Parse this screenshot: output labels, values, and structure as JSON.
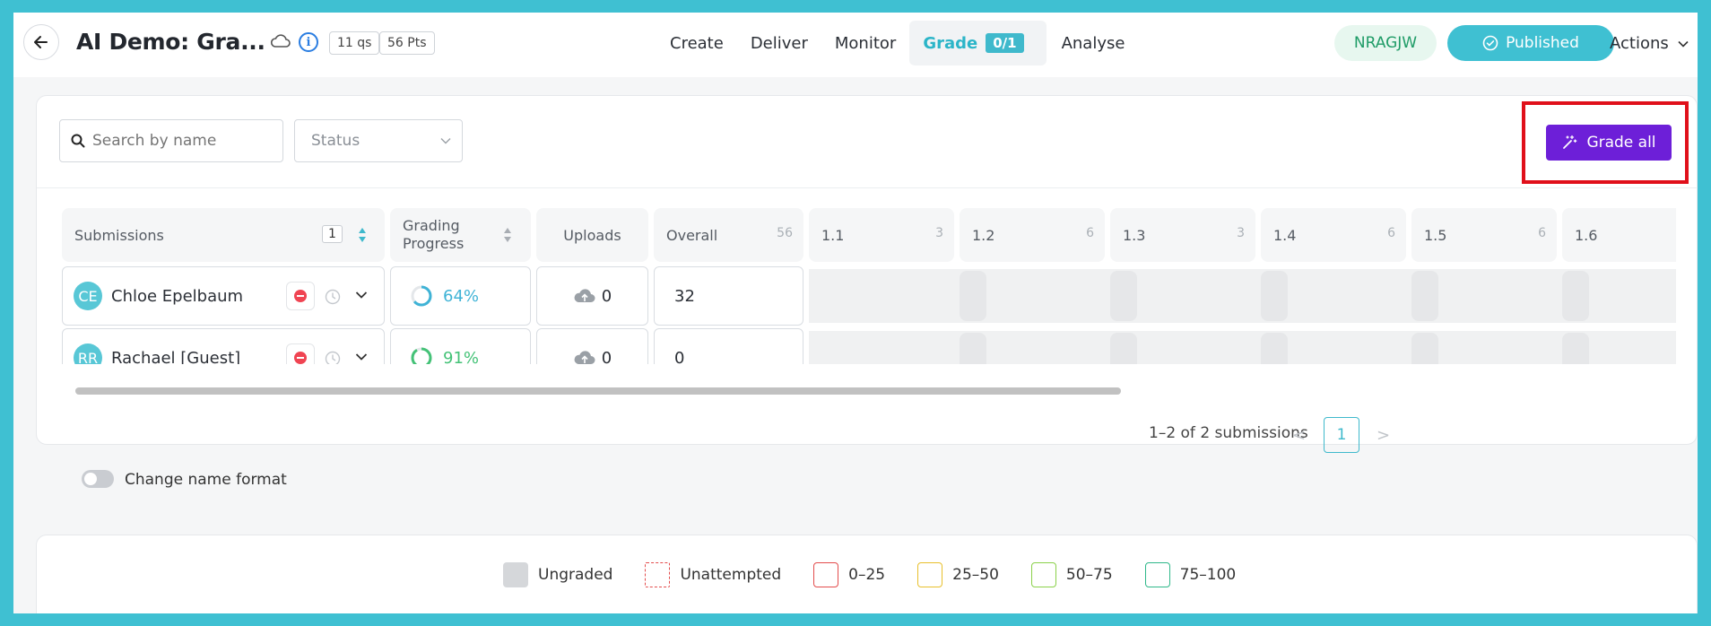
{
  "header": {
    "title": "AI Demo: Gra...",
    "questions_chip": "11 qs",
    "points_chip": "56 Pts",
    "nav": [
      {
        "label": "Create"
      },
      {
        "label": "Deliver"
      },
      {
        "label": "Monitor"
      },
      {
        "label": "Grade",
        "badge": "0/1",
        "active": true
      },
      {
        "label": "Analyse"
      }
    ],
    "room_code": "NRAGJW",
    "published_label": "Published",
    "actions_label": "Actions"
  },
  "toolbar": {
    "search_placeholder": "Search by name",
    "status_placeholder": "Status",
    "grade_all_label": "Grade all"
  },
  "table": {
    "headers": {
      "submissions": "Submissions",
      "submissions_count": "1",
      "grading_progress": "Grading\nProgress",
      "uploads": "Uploads",
      "overall": "Overall",
      "overall_points": "56"
    },
    "question_headers": [
      {
        "label": "1.1",
        "points": "3"
      },
      {
        "label": "1.2",
        "points": "6"
      },
      {
        "label": "1.3",
        "points": "3"
      },
      {
        "label": "1.4",
        "points": "6"
      },
      {
        "label": "1.5",
        "points": "6"
      },
      {
        "label": "1.6",
        "points": ""
      }
    ],
    "rows": [
      {
        "initials": "CE",
        "name": "Chloe Epelbaum",
        "progress_label": "64%",
        "progress": 0.64,
        "progress_color": "#3fb3d6",
        "uploads": "0",
        "overall": "32"
      },
      {
        "initials": "RR",
        "name": "Rachael [Guest]",
        "progress_label": "91%",
        "progress": 0.91,
        "progress_color": "#44c277",
        "uploads": "0",
        "overall": "0"
      }
    ]
  },
  "pagination": {
    "summary": "1–2 of 2 submissions",
    "current_page": "1",
    "prev": "<",
    "next": ">"
  },
  "name_format_label": "Change name format",
  "legend": [
    {
      "label": "Ungraded",
      "color": "#d5d7da",
      "style": "filled"
    },
    {
      "label": "Unattempted",
      "color": "#e34c4c",
      "style": "dashed"
    },
    {
      "label": "0–25",
      "color": "#e34c4c",
      "style": "outline"
    },
    {
      "label": "25–50",
      "color": "#e8c02c",
      "style": "outline"
    },
    {
      "label": "50–75",
      "color": "#8bd14a",
      "style": "outline"
    },
    {
      "label": "75–100",
      "color": "#2fb88a",
      "style": "outline"
    }
  ]
}
